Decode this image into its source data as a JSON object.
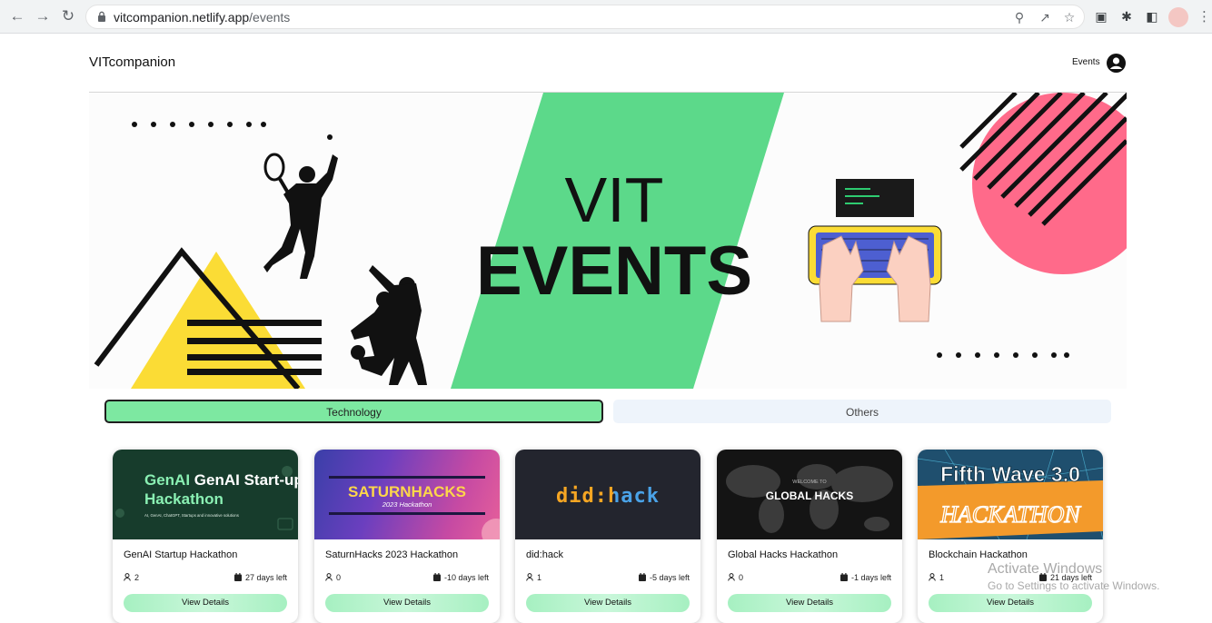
{
  "browser": {
    "url_host": "vitcompanion.netlify.app",
    "url_path": "/events"
  },
  "header": {
    "brand": "VITcompanion",
    "nav_events": "Events"
  },
  "banner": {
    "line1": "VIT",
    "line2": "EVENTS"
  },
  "tabs": [
    {
      "label": "Technology",
      "active": true
    },
    {
      "label": "Others",
      "active": false
    }
  ],
  "events": [
    {
      "title": "GenAI Startup Hackathon",
      "participants": "2",
      "days_left": "27 days left",
      "image": {
        "line1": "GenAI Start-up",
        "line2": "Hackathon",
        "caption": "AI, GenAI, ChatGPT, Startups and innovative solutions"
      }
    },
    {
      "title": "SaturnHacks 2023 Hackathon",
      "participants": "0",
      "days_left": "-10 days left",
      "image": {
        "line1": "SATURNHACKS",
        "line2": "2023 Hackathon"
      }
    },
    {
      "title": "did:hack",
      "participants": "1",
      "days_left": "-5 days left",
      "image": {
        "line1": "did:hack"
      }
    },
    {
      "title": "Global Hacks Hackathon",
      "participants": "0",
      "days_left": "-1 days left",
      "image": {
        "line1": "WELCOME TO",
        "line2": "GLOBAL HACKS"
      }
    },
    {
      "title": "Blockchain Hackathon",
      "participants": "1",
      "days_left": "21 days left",
      "image": {
        "line1": "Fifth Wave 3.0",
        "line2": "HACKATHON"
      }
    }
  ],
  "card_button_label": "View Details",
  "watermark": {
    "line1": "Activate Windows",
    "line2": "Go to Settings to activate Windows."
  },
  "colors": {
    "banner_green": "#5cd98a",
    "banner_yellow": "#fbdc35",
    "banner_pink": "#ff6a8a",
    "tab_active": "#7de8a1",
    "tab_inactive": "#eef4fb",
    "button_green": "#a6f0c1"
  }
}
